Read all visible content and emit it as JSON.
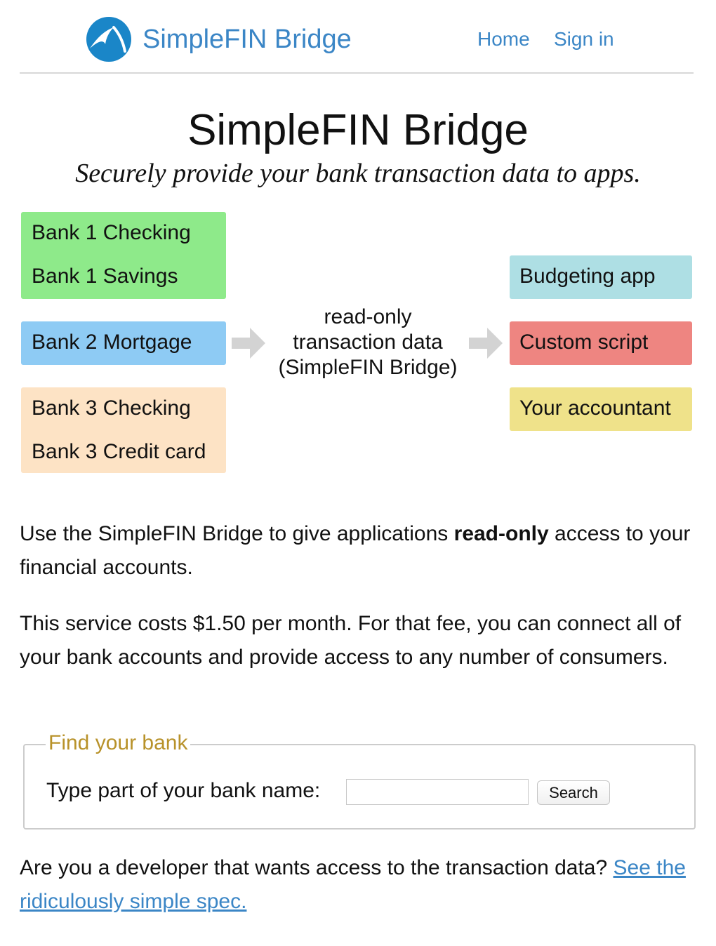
{
  "header": {
    "brand": "SimpleFIN Bridge",
    "nav": {
      "home": "Home",
      "sign_in": "Sign in"
    }
  },
  "hero": {
    "title": "SimpleFIN Bridge",
    "subtitle": "Securely provide your bank transaction data to apps."
  },
  "diagram": {
    "banks": {
      "bank1": [
        "Bank 1 Checking",
        "Bank 1 Savings"
      ],
      "bank2": [
        "Bank 2 Mortgage"
      ],
      "bank3": [
        "Bank 3 Checking",
        "Bank 3 Credit card"
      ]
    },
    "middle": [
      "read-only",
      "transaction data",
      "(SimpleFIN Bridge)"
    ],
    "consumers": [
      "Budgeting app",
      "Custom script",
      "Your accountant"
    ],
    "colors": {
      "bank1": "#8eea8a",
      "bank2": "#8ecbf4",
      "bank3": "#fde3c5",
      "budgeting": "#aedfe4",
      "script": "#ee8581",
      "accountant": "#efe28a",
      "arrow": "#d3d3d3"
    }
  },
  "intro": {
    "before": "Use the SimpleFIN Bridge to give applications ",
    "bold": "read-only",
    "after": " access to your financial accounts."
  },
  "pricing": "This service costs $1.50 per month. For that fee, you can connect all of your bank accounts and provide access to any number of consumers.",
  "find_bank": {
    "legend": "Find your bank",
    "label": "Type part of your bank name:",
    "input_value": "",
    "button": "Search"
  },
  "developer": {
    "text": "Are you a developer that wants access to the transaction data? ",
    "link": "See the ridiculously simple spec."
  },
  "theme": {
    "link_color": "#3b86c6",
    "legend_color": "#b8922a"
  }
}
